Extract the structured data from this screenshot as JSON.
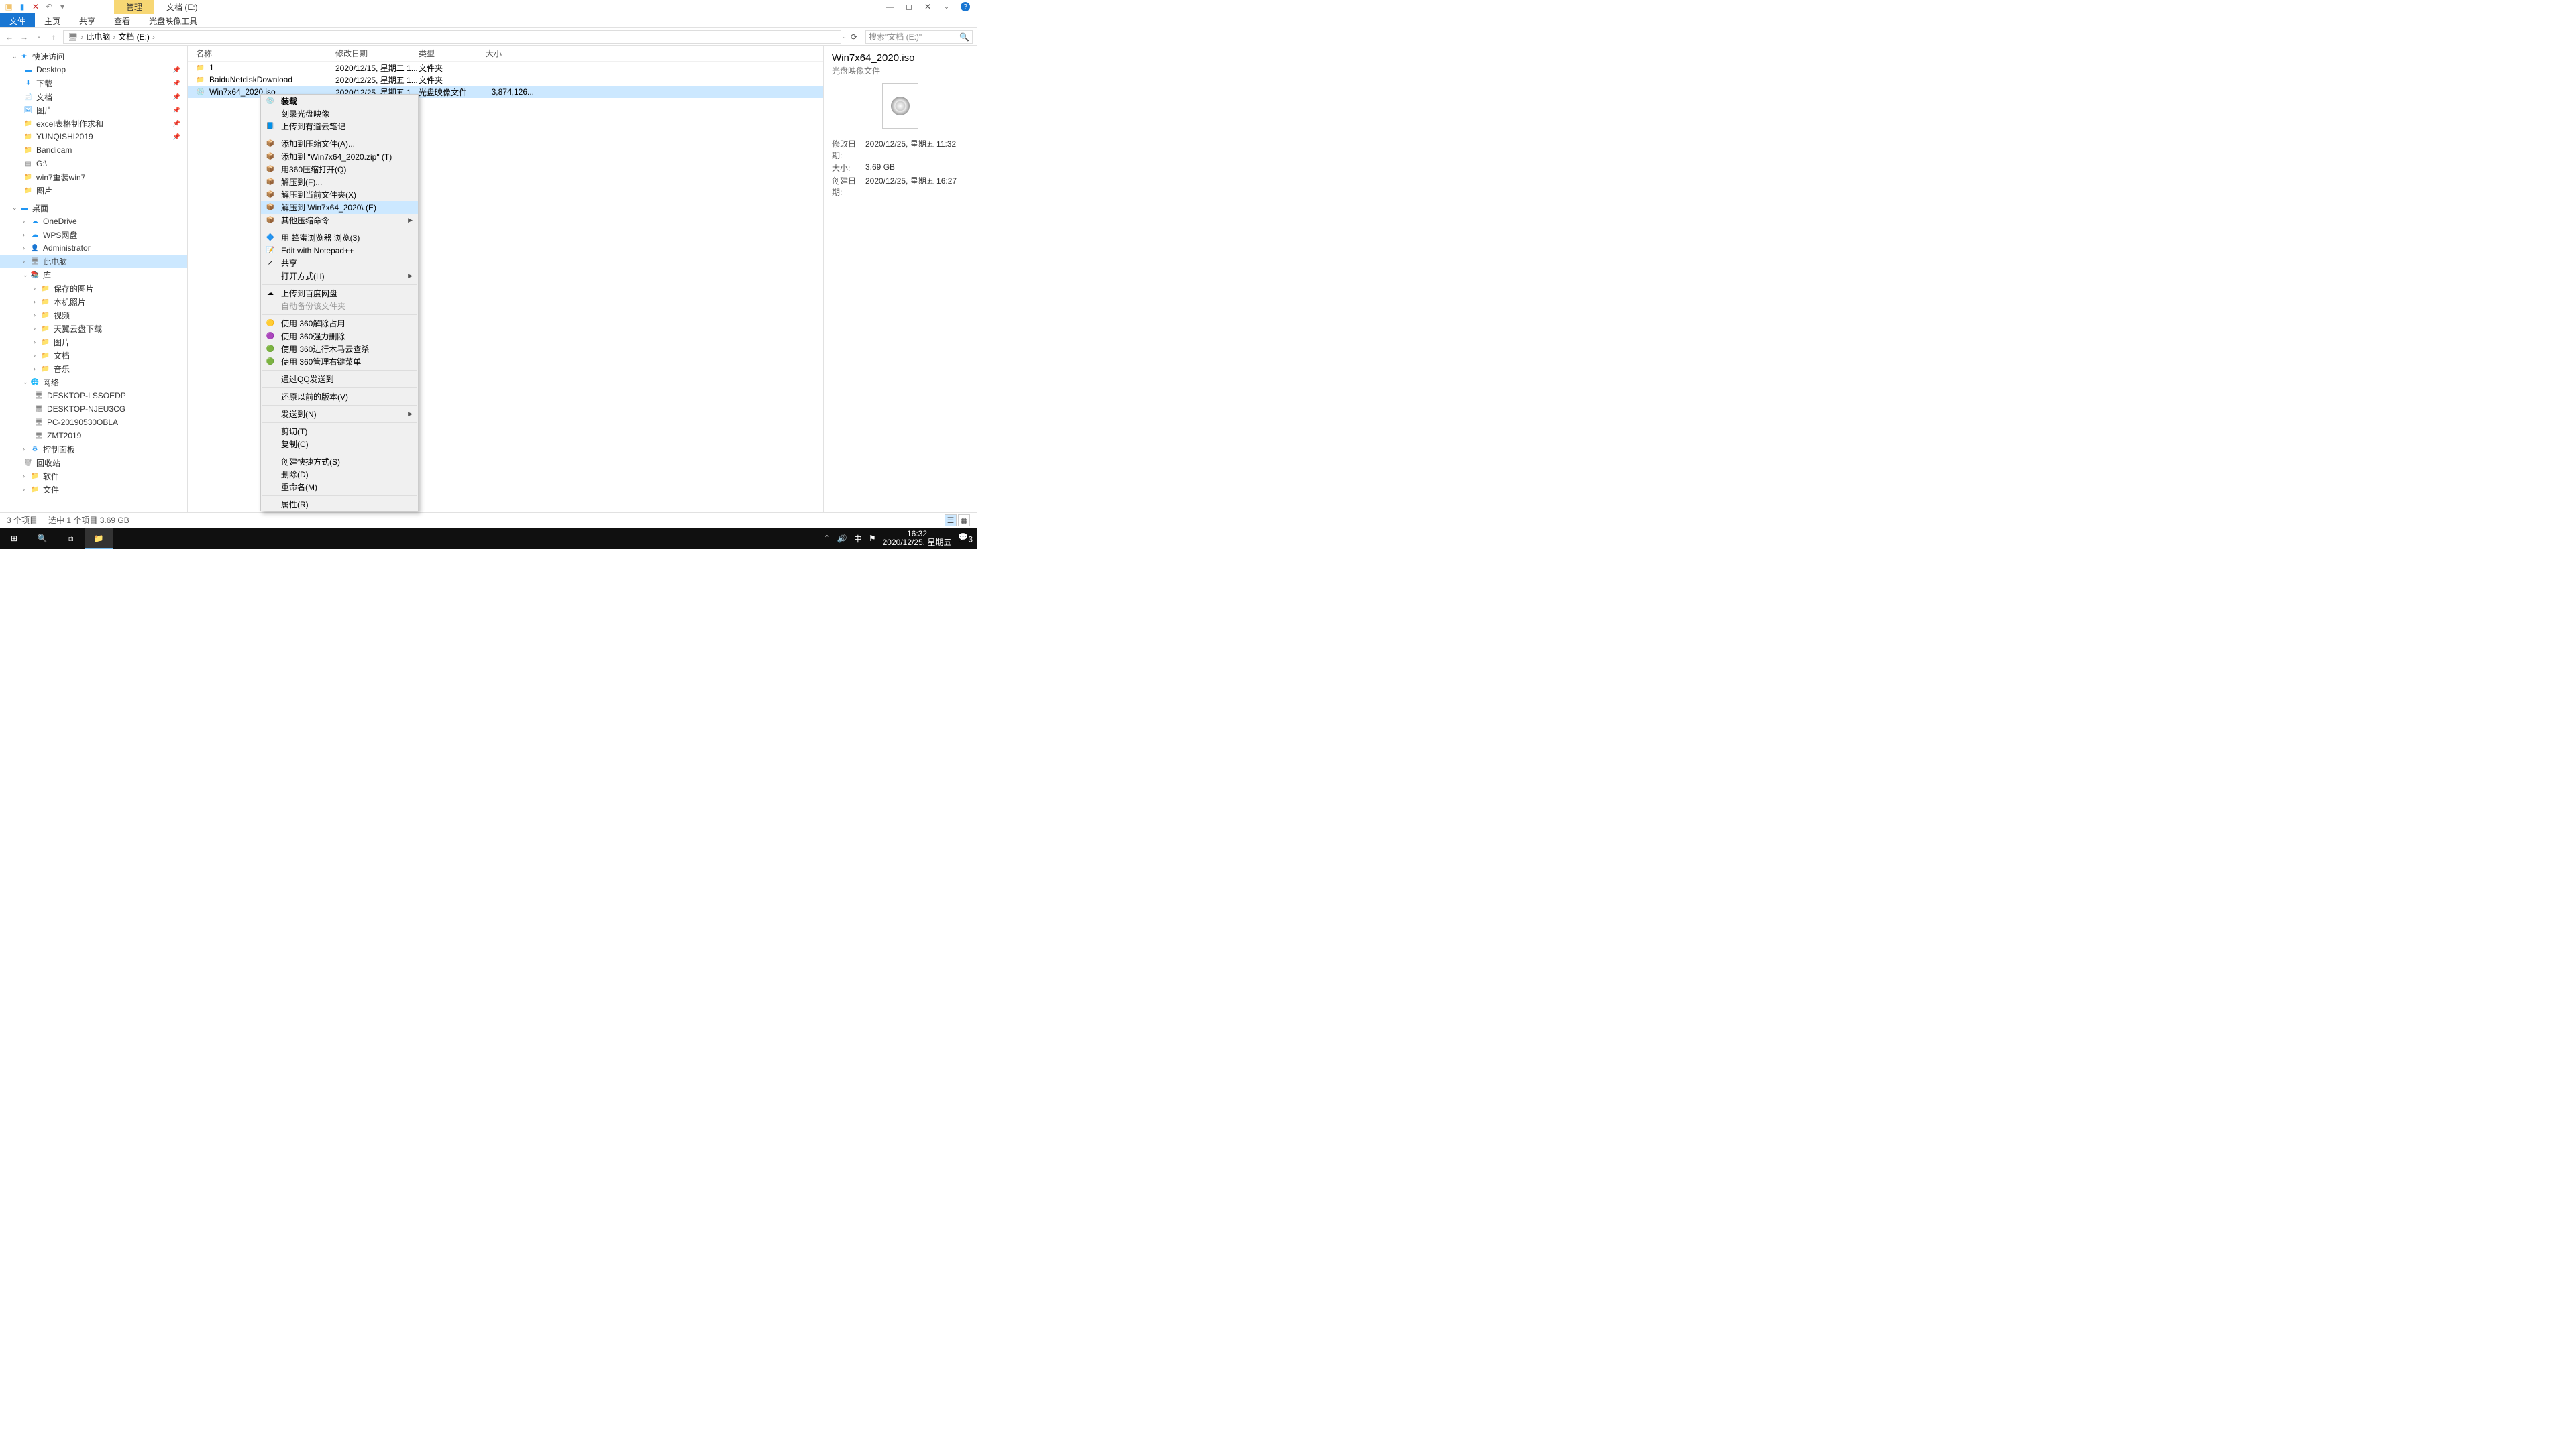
{
  "title": {
    "manage": "管理",
    "doc": "文档 (E:)"
  },
  "ribbon": {
    "file": "文件",
    "home": "主页",
    "share": "共享",
    "view": "查看",
    "iso": "光盘映像工具"
  },
  "crumbs": {
    "pc": "此电脑",
    "doc": "文档 (E:)"
  },
  "search": {
    "placeholder": "搜索\"文档 (E:)\""
  },
  "tree": {
    "quick": "快速访问",
    "desktop": "Desktop",
    "downloads": "下载",
    "documents": "文档",
    "pictures": "图片",
    "excel": "excel表格制作求和",
    "yunqi": "YUNQISHI2019",
    "bandicam": "Bandicam",
    "gdrive": "G:\\",
    "win7": "win7重装win7",
    "pics2": "图片",
    "desktopcn": "桌面",
    "onedrive": "OneDrive",
    "wps": "WPS网盘",
    "admin": "Administrator",
    "thispc": "此电脑",
    "library": "库",
    "saved": "保存的图片",
    "local": "本机照片",
    "video": "视频",
    "tianyi": "天翼云盘下载",
    "pics3": "图片",
    "docs2": "文档",
    "music": "音乐",
    "network": "网络",
    "d1": "DESKTOP-LSSOEDP",
    "d2": "DESKTOP-NJEU3CG",
    "d3": "PC-20190530OBLA",
    "d4": "ZMT2019",
    "control": "控制面板",
    "recycle": "回收站",
    "software": "软件",
    "files": "文件"
  },
  "cols": {
    "name": "名称",
    "date": "修改日期",
    "type": "类型",
    "size": "大小"
  },
  "rows": [
    {
      "name": "1",
      "date": "2020/12/15, 星期二 1...",
      "type": "文件夹",
      "size": ""
    },
    {
      "name": "BaiduNetdiskDownload",
      "date": "2020/12/25, 星期五 1...",
      "type": "文件夹",
      "size": ""
    },
    {
      "name": "Win7x64_2020.iso",
      "date": "2020/12/25, 星期五 1...",
      "type": "光盘映像文件",
      "size": "3,874,126..."
    }
  ],
  "details": {
    "title": "Win7x64_2020.iso",
    "sub": "光盘映像文件",
    "mod_l": "修改日期:",
    "mod_v": "2020/12/25, 星期五 11:32",
    "siz_l": "大小:",
    "siz_v": "3.69 GB",
    "crt_l": "创建日期:",
    "crt_v": "2020/12/25, 星期五 16:27"
  },
  "menu": [
    {
      "label": "装载",
      "icon": "💿",
      "bold": true
    },
    {
      "label": "刻录光盘映像"
    },
    {
      "label": "上传到有道云笔记",
      "icon": "📘"
    },
    {
      "sep": true
    },
    {
      "label": "添加到压缩文件(A)...",
      "icon": "📦"
    },
    {
      "label": "添加到 \"Win7x64_2020.zip\" (T)",
      "icon": "📦"
    },
    {
      "label": "用360压缩打开(Q)",
      "icon": "📦"
    },
    {
      "label": "解压到(F)...",
      "icon": "📦"
    },
    {
      "label": "解压到当前文件夹(X)",
      "icon": "📦"
    },
    {
      "label": "解压到 Win7x64_2020\\ (E)",
      "icon": "📦",
      "hi": true
    },
    {
      "label": "其他压缩命令",
      "icon": "📦",
      "sub": true
    },
    {
      "sep": true
    },
    {
      "label": "用 蜂蜜浏览器 浏览(3)",
      "icon": "🔷"
    },
    {
      "label": "Edit with Notepad++",
      "icon": "📝"
    },
    {
      "label": "共享",
      "icon": "↗"
    },
    {
      "label": "打开方式(H)",
      "sub": true
    },
    {
      "sep": true
    },
    {
      "label": "上传到百度网盘",
      "icon": "☁"
    },
    {
      "label": "自动备份该文件夹",
      "disabled": true
    },
    {
      "sep": true
    },
    {
      "label": "使用 360解除占用",
      "icon": "🟡"
    },
    {
      "label": "使用 360强力删除",
      "icon": "🟣"
    },
    {
      "label": "使用 360进行木马云查杀",
      "icon": "🟢"
    },
    {
      "label": "使用 360管理右键菜单",
      "icon": "🟢"
    },
    {
      "sep": true
    },
    {
      "label": "通过QQ发送到"
    },
    {
      "sep": true
    },
    {
      "label": "还原以前的版本(V)"
    },
    {
      "sep": true
    },
    {
      "label": "发送到(N)",
      "sub": true
    },
    {
      "sep": true
    },
    {
      "label": "剪切(T)"
    },
    {
      "label": "复制(C)"
    },
    {
      "sep": true
    },
    {
      "label": "创建快捷方式(S)"
    },
    {
      "label": "删除(D)"
    },
    {
      "label": "重命名(M)"
    },
    {
      "sep": true
    },
    {
      "label": "属性(R)"
    }
  ],
  "status": {
    "count": "3 个项目",
    "sel": "选中 1 个项目  3.69 GB"
  },
  "taskbar": {
    "time": "16:32",
    "date": "2020/12/25, 星期五",
    "badge": "3",
    "ime": "中"
  }
}
